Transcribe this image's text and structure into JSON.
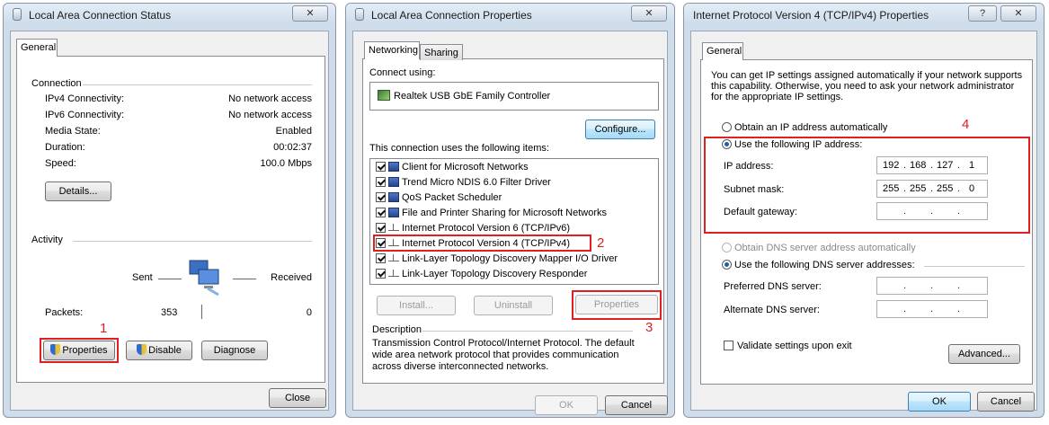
{
  "status_dialog": {
    "title": "Local Area Connection Status",
    "close_glyph": "✕",
    "tab_general": "General",
    "connection": {
      "heading": "Connection",
      "rows": [
        {
          "label": "IPv4 Connectivity:",
          "value": "No network access"
        },
        {
          "label": "IPv6 Connectivity:",
          "value": "No network access"
        },
        {
          "label": "Media State:",
          "value": "Enabled"
        },
        {
          "label": "Duration:",
          "value": "00:02:37"
        },
        {
          "label": "Speed:",
          "value": "100.0 Mbps"
        }
      ],
      "details_button": "Details..."
    },
    "activity": {
      "heading": "Activity",
      "sent_label": "Sent",
      "received_label": "Received",
      "packets_label": "Packets:",
      "packets_sent": "353",
      "packets_received": "0"
    },
    "buttons": {
      "properties": "Properties",
      "disable": "Disable",
      "diagnose": "Diagnose",
      "close": "Close"
    },
    "step_number": "1"
  },
  "properties_dialog": {
    "title": "Local Area Connection Properties",
    "close_glyph": "✕",
    "tabs": [
      "Networking",
      "Sharing"
    ],
    "connect_using_label": "Connect using:",
    "adapter_name": "Realtek USB GbE Family Controller",
    "configure_button": "Configure...",
    "items_label": "This connection uses the following items:",
    "items": [
      {
        "label": "Client for Microsoft Networks",
        "checked": true,
        "icon": "network-client-icon"
      },
      {
        "label": "Trend Micro NDIS 6.0 Filter Driver",
        "checked": true,
        "icon": "network-service-icon"
      },
      {
        "label": "QoS Packet Scheduler",
        "checked": true,
        "icon": "network-service-icon"
      },
      {
        "label": "File and Printer Sharing for Microsoft Networks",
        "checked": true,
        "icon": "network-service-icon"
      },
      {
        "label": "Internet Protocol Version 6 (TCP/IPv6)",
        "checked": true,
        "icon": "protocol-icon"
      },
      {
        "label": "Internet Protocol Version 4 (TCP/IPv4)",
        "checked": true,
        "icon": "protocol-icon"
      },
      {
        "label": "Link-Layer Topology Discovery Mapper I/O Driver",
        "checked": true,
        "icon": "protocol-icon"
      },
      {
        "label": "Link-Layer Topology Discovery Responder",
        "checked": true,
        "icon": "protocol-icon"
      }
    ],
    "buttons": {
      "install": "Install...",
      "uninstall": "Uninstall",
      "properties": "Properties",
      "ok": "OK",
      "cancel": "Cancel"
    },
    "description_heading": "Description",
    "description_text": "Transmission Control Protocol/Internet Protocol. The default wide area network protocol that provides communication across diverse interconnected networks.",
    "step_item": "2",
    "step_properties": "3"
  },
  "ipv4_dialog": {
    "title": "Internet Protocol Version 4 (TCP/IPv4) Properties",
    "help_glyph": "?",
    "close_glyph": "✕",
    "tab_general": "General",
    "intro_text": "You can get IP settings assigned automatically if your network supports this capability. Otherwise, you need to ask your network administrator for the appropriate IP settings.",
    "radio_auto_ip": "Obtain an IP address automatically",
    "radio_manual_ip": "Use the following IP address:",
    "ip_address_label": "IP address:",
    "ip_address": [
      "192",
      "168",
      "127",
      "1"
    ],
    "subnet_label": "Subnet mask:",
    "subnet_mask": [
      "255",
      "255",
      "255",
      "0"
    ],
    "gateway_label": "Default gateway:",
    "gateway": [
      "",
      "",
      "",
      ""
    ],
    "radio_auto_dns": "Obtain DNS server address automatically",
    "radio_manual_dns": "Use the following DNS server addresses:",
    "preferred_dns_label": "Preferred DNS server:",
    "preferred_dns": [
      "",
      "",
      "",
      ""
    ],
    "alternate_dns_label": "Alternate DNS server:",
    "alternate_dns": [
      "",
      "",
      "",
      ""
    ],
    "validate_label": "Validate settings upon exit",
    "validate_checked": false,
    "buttons": {
      "advanced": "Advanced...",
      "ok": "OK",
      "cancel": "Cancel"
    },
    "step_number": "4",
    "selected_mode": "manual"
  },
  "colors": {
    "highlight_red": "#e02020",
    "title_blue": "#cfdcea"
  }
}
